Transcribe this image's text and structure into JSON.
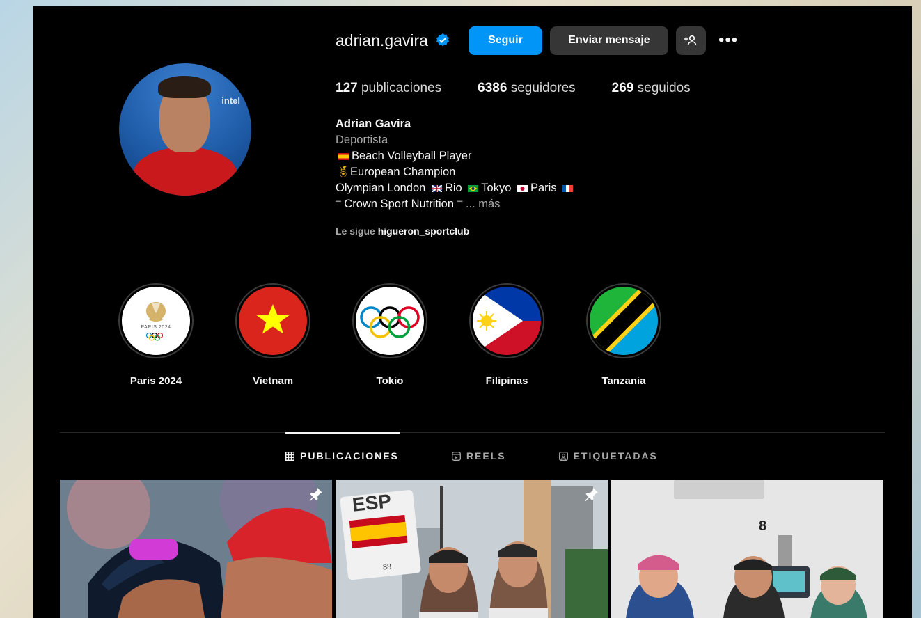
{
  "profile": {
    "username": "adrian.gavira",
    "follow_label": "Seguir",
    "message_label": "Enviar mensaje",
    "add_user_icon": "add-user-icon",
    "more_icon": "more-icon",
    "avatar_text": "intel"
  },
  "stats": {
    "posts_count": "127",
    "posts_label": "publicaciones",
    "followers_count": "6386",
    "followers_label": "seguidores",
    "following_count": "269",
    "following_label": "seguidos"
  },
  "bio": {
    "name": "Adrian Gavira",
    "category": "Deportista",
    "line1": "Beach Volleyball Player",
    "line2": "European Champion",
    "line3_prefix": "Olympian London",
    "line3_rio": "Rio",
    "line3_tokyo": "Tokyo",
    "line3_paris": "Paris",
    "line4": "Crown Sport Nutrition",
    "more_link": "... más"
  },
  "followed_by": {
    "prefix": "Le sigue",
    "user": "higueron_sportclub"
  },
  "highlights": [
    {
      "label": "Paris 2024",
      "inner_text": "PARIS 2024"
    },
    {
      "label": "Vietnam"
    },
    {
      "label": "Tokio"
    },
    {
      "label": "Filipinas"
    },
    {
      "label": "Tanzania"
    }
  ],
  "tabs": [
    {
      "label": "PUBLICACIONES",
      "icon": "grid-icon",
      "active": true
    },
    {
      "label": "REELS",
      "icon": "reels-icon",
      "active": false
    },
    {
      "label": "ETIQUETADAS",
      "icon": "tagged-icon",
      "active": false
    }
  ],
  "posts": [
    {
      "pinned": true
    },
    {
      "pinned": true,
      "sign_text": "ESP",
      "sign_small": "88"
    },
    {
      "pinned": false,
      "room_number": "8"
    }
  ],
  "colors": {
    "accent": "#0095f6",
    "button_dark": "#363636",
    "background": "#000000"
  }
}
